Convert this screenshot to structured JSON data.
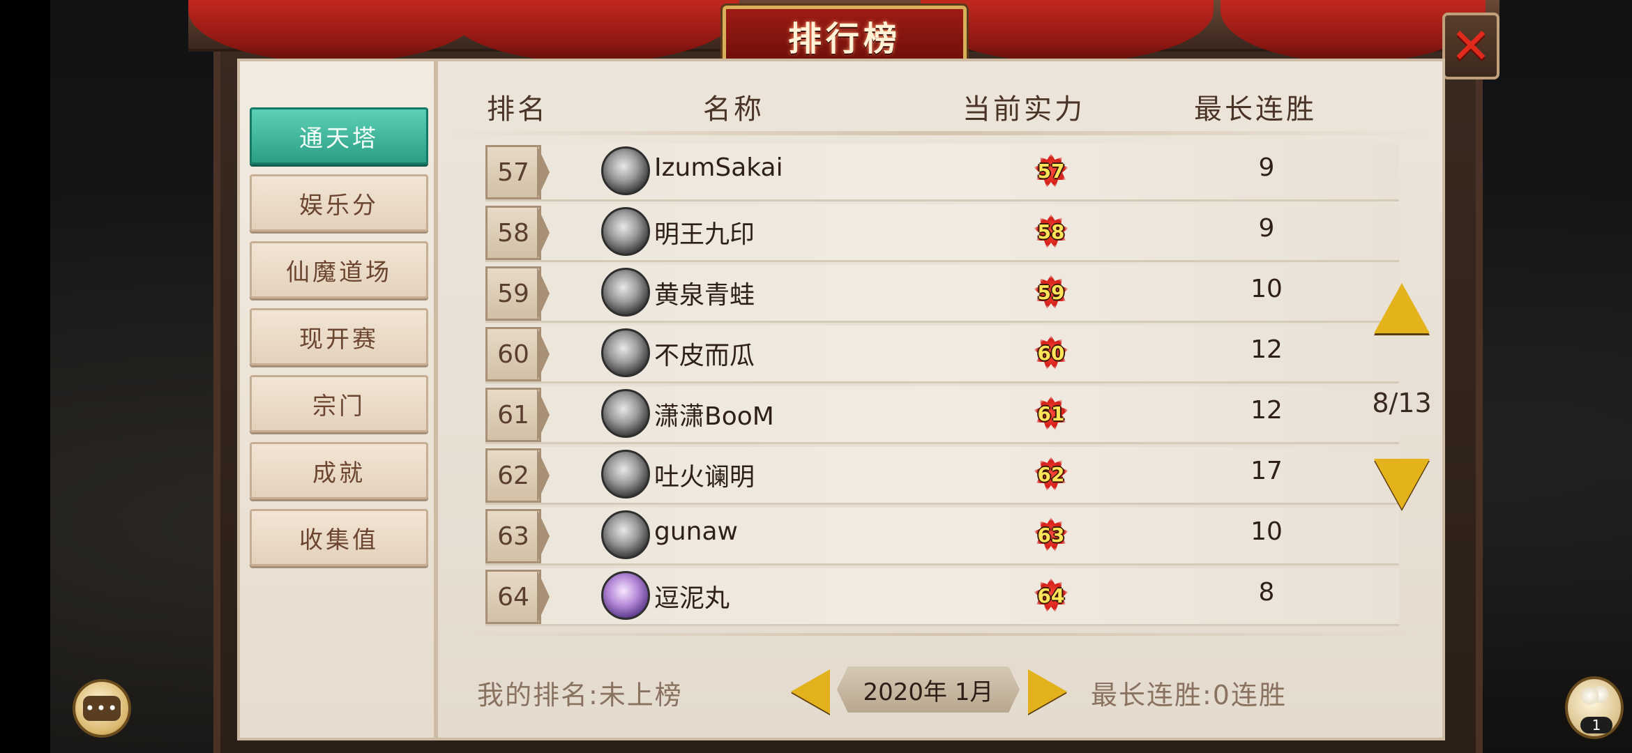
{
  "title": "排行榜",
  "close_label": "✕",
  "sidebar": {
    "tabs": [
      {
        "label": "通天塔",
        "active": true
      },
      {
        "label": "娱乐分",
        "active": false
      },
      {
        "label": "仙魔道场",
        "active": false
      },
      {
        "label": "现开赛",
        "active": false
      },
      {
        "label": "宗门",
        "active": false
      },
      {
        "label": "成就",
        "active": false
      },
      {
        "label": "收集值",
        "active": false
      }
    ]
  },
  "table": {
    "headers": {
      "rank": "排名",
      "name": "名称",
      "power": "当前实力",
      "streak": "最长连胜"
    },
    "rows": [
      {
        "rank": "57",
        "name": "IzumSakai",
        "power": "57",
        "streak": "9"
      },
      {
        "rank": "58",
        "name": "明王九印",
        "power": "58",
        "streak": "9"
      },
      {
        "rank": "59",
        "name": "黄泉青蛙",
        "power": "59",
        "streak": "10"
      },
      {
        "rank": "60",
        "name": "不皮而瓜",
        "power": "60",
        "streak": "12"
      },
      {
        "rank": "61",
        "name": "潇潇BooM",
        "power": "61",
        "streak": "12"
      },
      {
        "rank": "62",
        "name": "吐火谰明",
        "power": "62",
        "streak": "17"
      },
      {
        "rank": "63",
        "name": "gunaw",
        "power": "63",
        "streak": "10"
      },
      {
        "rank": "64",
        "name": "逗泥丸",
        "power": "64",
        "streak": "8"
      }
    ]
  },
  "pagination": {
    "indicator": "8/13"
  },
  "footer": {
    "my_rank": "我的排名:未上榜",
    "date": "2020年 1月",
    "my_streak": "最长连胜:0连胜"
  },
  "chat_icon_glyph": "•••",
  "friends_count": "1",
  "colors": {
    "active_tab": "#2b9e85",
    "arrow_gold": "#e4b21b",
    "close_red": "#e02a1c",
    "title_red": "#9e1b14"
  }
}
